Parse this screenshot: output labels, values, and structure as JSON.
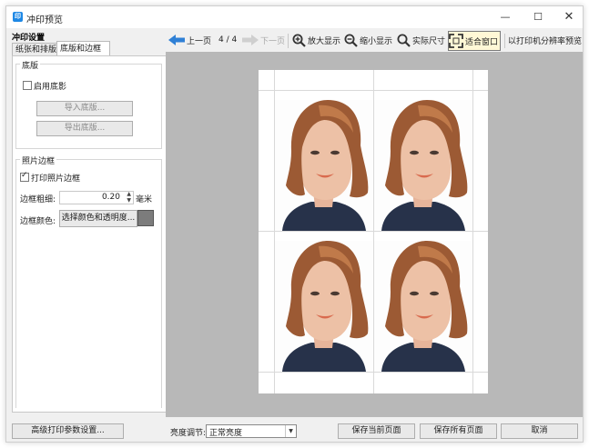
{
  "window": {
    "title": "冲印预览",
    "app_icon_letter": "印",
    "controls": {
      "minimize": "—",
      "maximize": "☐",
      "close": "✕"
    }
  },
  "left_panel": {
    "heading": "冲印设置",
    "tabs": [
      {
        "label": "纸张和排版",
        "selected": false
      },
      {
        "label": "底版和边框",
        "selected": true
      }
    ],
    "underlay_group": {
      "title": "底版",
      "enable_label": "启用底影",
      "enable_checked": false,
      "import_button": "导入底版...",
      "export_button": "导出底版..."
    },
    "border_group": {
      "title": "照片边框",
      "print_border_label": "打印照片边框",
      "print_border_checked": true,
      "thickness_label": "边框粗细:",
      "thickness_value": "0.20",
      "thickness_unit": "毫米",
      "color_label": "边框颜色:",
      "color_button": "选择颜色和透明度...",
      "border_color": "#7c7c7c"
    }
  },
  "toolbar": {
    "prev_page": "上一页",
    "page_indicator": "4 / 4",
    "next_page": "下一页",
    "zoom_in": "放大显示",
    "zoom_out": "缩小显示",
    "actual_size": "实际尺寸",
    "fit_window": "适合窗口",
    "printer_resolution_preview": "以打印机分辨率预览"
  },
  "preview": {
    "photo_count": 4,
    "layout": "2x2"
  },
  "bottom_bar": {
    "advanced_button": "高级打印参数设置...",
    "brightness_label": "亮度调节:",
    "brightness_value": "正常亮度",
    "save_current_button": "保存当前页面",
    "save_all_button": "保存所有页面",
    "cancel_button": "取消"
  },
  "colors": {
    "accent_blue": "#1e88e5",
    "preview_background": "#b8b8b8",
    "active_tool_highlight": "#fff8d6"
  }
}
